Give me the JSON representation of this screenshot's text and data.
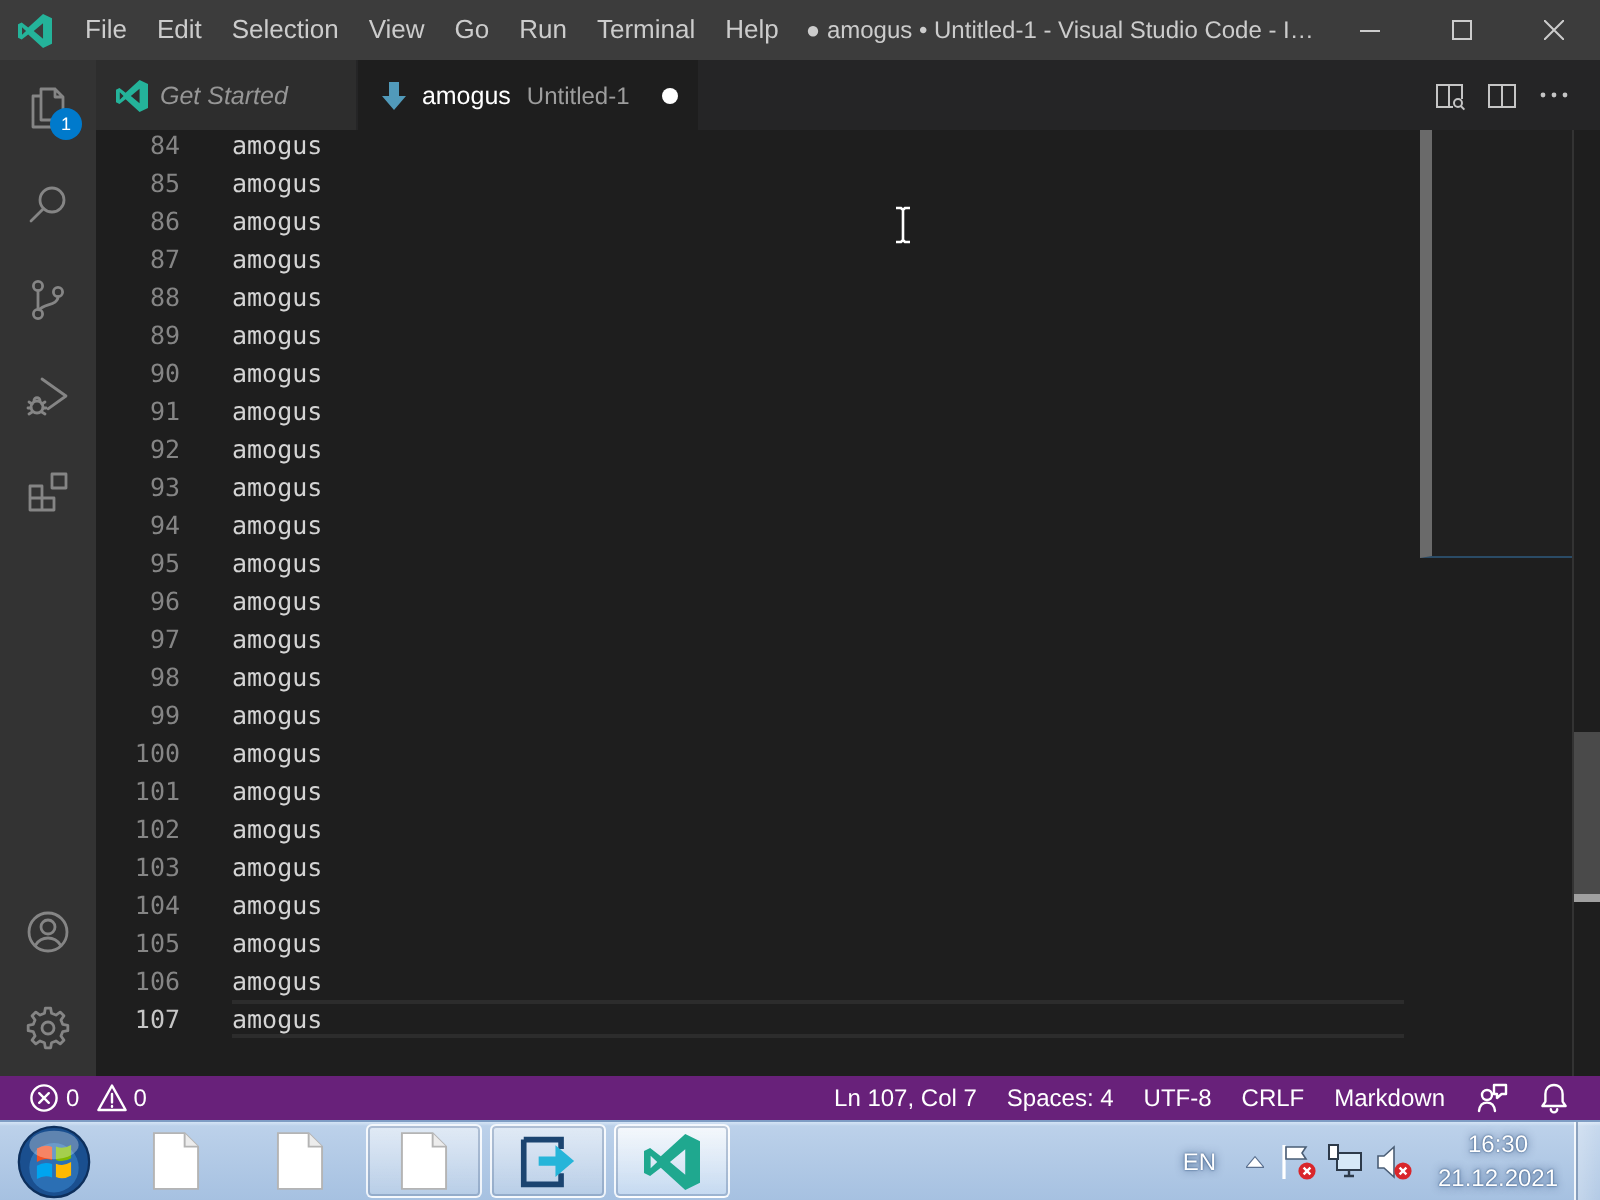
{
  "window": {
    "title": "● amogus • Untitled-1 - Visual Studio Code - I…"
  },
  "menu": [
    "File",
    "Edit",
    "Selection",
    "View",
    "Go",
    "Run",
    "Terminal",
    "Help"
  ],
  "activity_bar": {
    "top": [
      {
        "kind": "explorer",
        "badge": "1"
      },
      {
        "kind": "search"
      },
      {
        "kind": "source-control"
      },
      {
        "kind": "run-debug"
      },
      {
        "kind": "extensions"
      }
    ],
    "bottom": [
      {
        "kind": "accounts"
      },
      {
        "kind": "settings"
      }
    ]
  },
  "tabs": [
    {
      "kind": "welcome",
      "label": "Get Started",
      "selected": false,
      "preview": true,
      "dirty": false
    },
    {
      "kind": "markdown",
      "label": "amogus",
      "description": "Untitled-1",
      "selected": true,
      "preview": false,
      "dirty": true
    }
  ],
  "editor": {
    "lines": [
      {
        "number": "84",
        "text": "amogus",
        "current": false
      },
      {
        "number": "85",
        "text": "amogus",
        "current": false
      },
      {
        "number": "86",
        "text": "amogus",
        "current": false
      },
      {
        "number": "87",
        "text": "amogus",
        "current": false
      },
      {
        "number": "88",
        "text": "amogus",
        "current": false
      },
      {
        "number": "89",
        "text": "amogus",
        "current": false
      },
      {
        "number": "90",
        "text": "amogus",
        "current": false
      },
      {
        "number": "91",
        "text": "amogus",
        "current": false
      },
      {
        "number": "92",
        "text": "amogus",
        "current": false
      },
      {
        "number": "93",
        "text": "amogus",
        "current": false
      },
      {
        "number": "94",
        "text": "amogus",
        "current": false
      },
      {
        "number": "95",
        "text": "amogus",
        "current": false
      },
      {
        "number": "96",
        "text": "amogus",
        "current": false
      },
      {
        "number": "97",
        "text": "amogus",
        "current": false
      },
      {
        "number": "98",
        "text": "amogus",
        "current": false
      },
      {
        "number": "99",
        "text": "amogus",
        "current": false
      },
      {
        "number": "100",
        "text": "amogus",
        "current": false
      },
      {
        "number": "101",
        "text": "amogus",
        "current": false
      },
      {
        "number": "102",
        "text": "amogus",
        "current": false
      },
      {
        "number": "103",
        "text": "amogus",
        "current": false
      },
      {
        "number": "104",
        "text": "amogus",
        "current": false
      },
      {
        "number": "105",
        "text": "amogus",
        "current": false
      },
      {
        "number": "106",
        "text": "amogus",
        "current": false
      },
      {
        "number": "107",
        "text": "amogus",
        "current": true
      }
    ]
  },
  "status_bar": {
    "problems": [
      {
        "kind": "error",
        "count": "0"
      },
      {
        "kind": "warning",
        "count": "0"
      }
    ],
    "items": [
      "Ln 107, Col 7",
      "Spaces: 4",
      "UTF-8",
      "CRLF",
      "Markdown"
    ],
    "icons": [
      {
        "kind": "feedback"
      },
      {
        "kind": "notifications"
      }
    ]
  },
  "taskbar": {
    "buttons": [
      {
        "kind": "document",
        "running": false,
        "selected": false
      },
      {
        "kind": "document",
        "running": false,
        "selected": false
      },
      {
        "kind": "document",
        "running": true,
        "selected": false
      },
      {
        "kind": "remote",
        "running": true,
        "selected": false
      },
      {
        "kind": "vscode",
        "running": true,
        "selected": true
      }
    ],
    "language": "EN",
    "tray": [
      {
        "kind": "show-hidden"
      },
      {
        "kind": "action-center",
        "alert": true
      },
      {
        "kind": "network",
        "alert": false
      },
      {
        "kind": "volume",
        "alert": true
      }
    ],
    "time": "16:30",
    "date": "21.12.2021"
  }
}
